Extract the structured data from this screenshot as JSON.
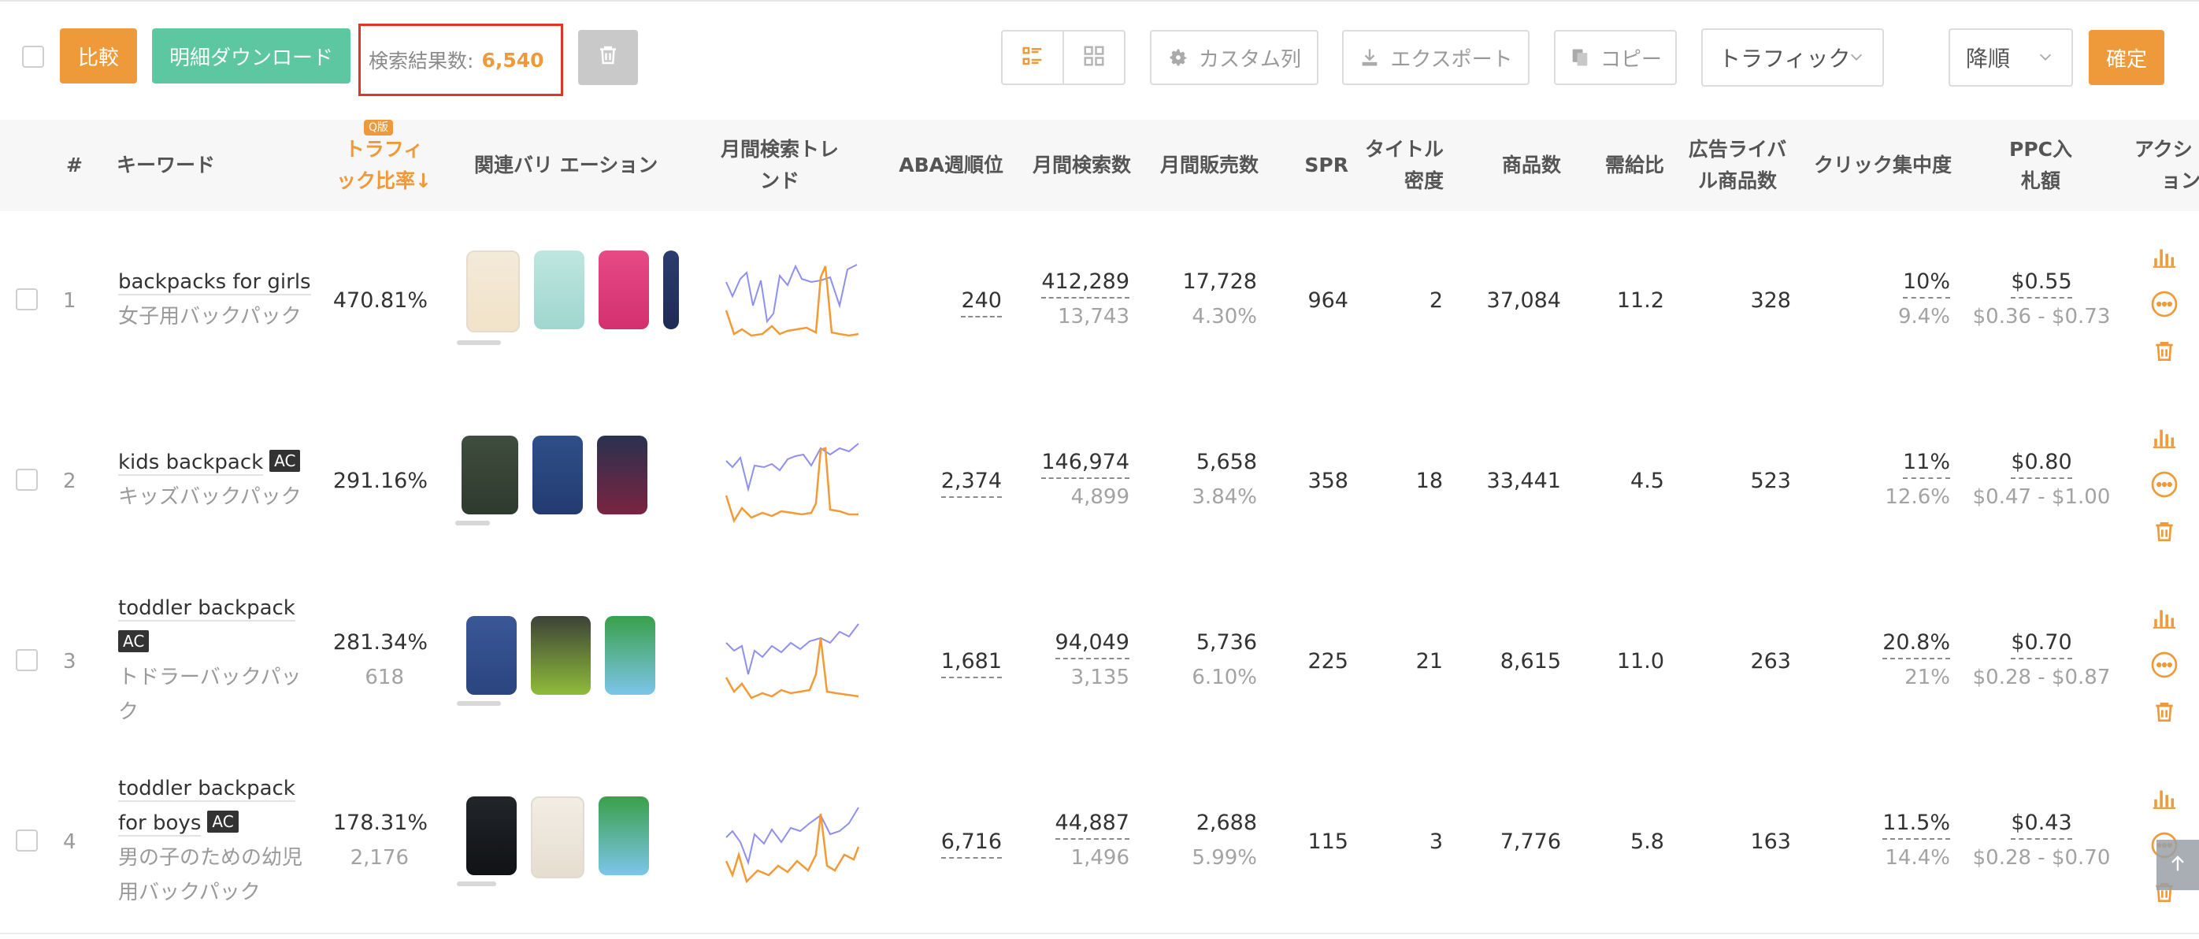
{
  "toolbar": {
    "compare_label": "比較",
    "download_label": "明細ダウンロード",
    "result_label": "検索結果数:",
    "result_count": "6,540",
    "custom_columns_label": "カスタム列",
    "export_label": "エクスポート",
    "copy_label": "コピー",
    "sort_field": "トラフィック比",
    "sort_order": "降順",
    "confirm_label": "確定"
  },
  "table": {
    "headers": {
      "index": "#",
      "keyword": "キーワード",
      "traffic_ratio_line1": "トラフィ",
      "traffic_ratio_line2": "ック比率↓",
      "traffic_badge": "Q版",
      "variations": "関連バリ エーション",
      "trend_line1": "月間検索トレ",
      "trend_line2": "ンド",
      "aba": "ABA週順位",
      "monthly_search": "月間検索数",
      "monthly_sales": "月間販売数",
      "spr": "SPR",
      "title_density_line1": "タイトル",
      "title_density_line2": "密度",
      "products": "商品数",
      "supply_ratio": "需給比",
      "ad_rivals_line1": "広告ライバ",
      "ad_rivals_line2": "ル商品数",
      "click_concentration": "クリック集中度",
      "ppc_line1": "PPC入",
      "ppc_line2": "札額",
      "actions": "アクシ",
      "actions_line2": "ョン"
    },
    "rows": [
      {
        "index": "1",
        "keyword_en": "backpacks for girls",
        "keyword_ac": "",
        "keyword_jp": "女子用バックパック",
        "traffic_ratio": "470.81%",
        "traffic_sub": "",
        "aba": "240",
        "monthly_search": "412,289",
        "monthly_search_sub": "13,743",
        "monthly_sales": "17,728",
        "monthly_sales_sub": "4.30%",
        "spr": "964",
        "title_density": "2",
        "products": "37,084",
        "supply_ratio": "11.2",
        "ad_rivals": "328",
        "click_concentration": "10%",
        "click_concentration_sub": "9.4%",
        "ppc": "$0.55",
        "ppc_range": "$0.36 - $0.73"
      },
      {
        "index": "2",
        "keyword_en": "kids backpack",
        "keyword_ac": "AC",
        "keyword_jp": "キッズバックパック",
        "traffic_ratio": "291.16%",
        "traffic_sub": "",
        "aba": "2,374",
        "monthly_search": "146,974",
        "monthly_search_sub": "4,899",
        "monthly_sales": "5,658",
        "monthly_sales_sub": "3.84%",
        "spr": "358",
        "title_density": "18",
        "products": "33,441",
        "supply_ratio": "4.5",
        "ad_rivals": "523",
        "click_concentration": "11%",
        "click_concentration_sub": "12.6%",
        "ppc": "$0.80",
        "ppc_range": "$0.47 - $1.00"
      },
      {
        "index": "3",
        "keyword_en": "toddler backpack",
        "keyword_ac": "AC",
        "keyword_jp": "トドラーバックパッ",
        "keyword_jp2": "ク",
        "traffic_ratio": "281.34%",
        "traffic_sub": "618",
        "aba": "1,681",
        "monthly_search": "94,049",
        "monthly_search_sub": "3,135",
        "monthly_sales": "5,736",
        "monthly_sales_sub": "6.10%",
        "spr": "225",
        "title_density": "21",
        "products": "8,615",
        "supply_ratio": "11.0",
        "ad_rivals": "263",
        "click_concentration": "20.8%",
        "click_concentration_sub": "21%",
        "ppc": "$0.70",
        "ppc_range": "$0.28 - $0.87"
      },
      {
        "index": "4",
        "keyword_en": "toddler backpack",
        "keyword_en2": "for boys",
        "keyword_ac": "AC",
        "keyword_jp": "男の子のための幼児",
        "keyword_jp2": "用バックパック",
        "traffic_ratio": "178.31%",
        "traffic_sub": "2,176",
        "aba": "6,716",
        "monthly_search": "44,887",
        "monthly_search_sub": "1,496",
        "monthly_sales": "2,688",
        "monthly_sales_sub": "5.99%",
        "spr": "115",
        "title_density": "3",
        "products": "7,776",
        "supply_ratio": "5.8",
        "ad_rivals": "163",
        "click_concentration": "11.5%",
        "click_concentration_sub": "14.4%",
        "ppc": "$0.43",
        "ppc_range": "$0.28 - $0.70"
      }
    ]
  },
  "colors": {
    "accent_orange": "#ef9a3a",
    "accent_green": "#5cc7a1",
    "highlight_red": "#e0362a",
    "trend_blue": "#8f8ff0",
    "trend_orange": "#f39a36"
  },
  "icons": [
    "list-view-icon",
    "grid-view-icon",
    "gear-icon",
    "download-icon",
    "copy-icon",
    "trash-icon",
    "chevron-down-icon",
    "bar-chart-icon",
    "more-icon",
    "arrow-up-icon"
  ]
}
